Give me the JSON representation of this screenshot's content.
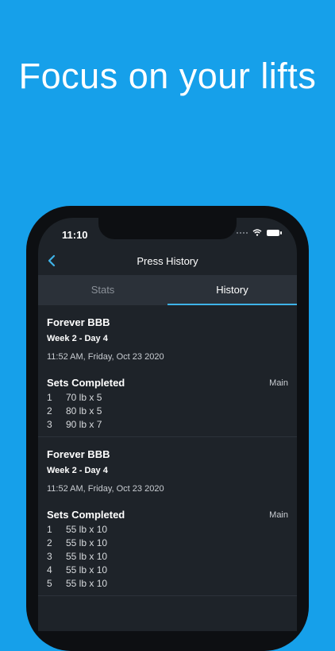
{
  "headline": "Focus on your lifts",
  "status_bar": {
    "time": "11:10"
  },
  "nav": {
    "title": "Press History"
  },
  "tabs": [
    {
      "label": "Stats",
      "active": false
    },
    {
      "label": "History",
      "active": true
    }
  ],
  "entries": [
    {
      "program": "Forever BBB",
      "week": "Week 2 - Day 4",
      "timestamp": "11:52 AM, Friday, Oct 23 2020",
      "sets_title": "Sets Completed",
      "sets_tag": "Main",
      "sets": [
        {
          "num": "1",
          "detail": "70 lb x 5"
        },
        {
          "num": "2",
          "detail": "80 lb x 5"
        },
        {
          "num": "3",
          "detail": "90 lb x 7"
        }
      ]
    },
    {
      "program": "Forever BBB",
      "week": "Week 2 - Day 4",
      "timestamp": "11:52 AM, Friday, Oct 23 2020",
      "sets_title": "Sets Completed",
      "sets_tag": "Main",
      "sets": [
        {
          "num": "1",
          "detail": "55 lb x 10"
        },
        {
          "num": "2",
          "detail": "55 lb x 10"
        },
        {
          "num": "3",
          "detail": "55 lb x 10"
        },
        {
          "num": "4",
          "detail": "55 lb x 10"
        },
        {
          "num": "5",
          "detail": "55 lb x 10"
        }
      ]
    }
  ],
  "colors": {
    "background": "#16a0ea",
    "accent": "#3fb3e8",
    "screen": "#1e2329"
  },
  "icons": [
    "back-chevron-icon",
    "signal-icon",
    "wifi-icon",
    "battery-icon"
  ]
}
